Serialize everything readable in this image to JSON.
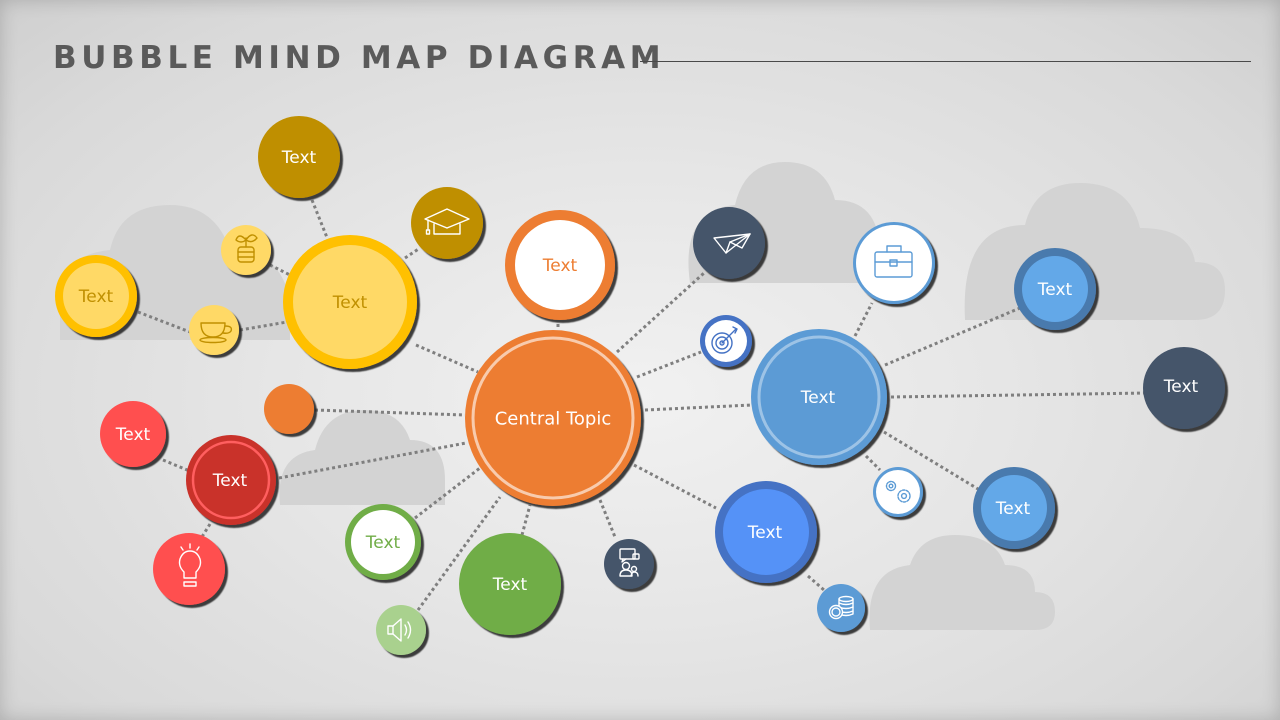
{
  "title": "BUBBLE MIND MAP DIAGRAM",
  "colors": {
    "orange": "#ED7D31",
    "gold": "#BF8F00",
    "yellow_ring": "#FFC000",
    "yellow_fill": "#FFD966",
    "yellow_text": "#C09000",
    "red": "#FF5050",
    "dark_red": "#C9302C",
    "green": "#70AD47",
    "light_green": "#A9D18E",
    "navy": "#44546A",
    "blue": "#5B9BD5",
    "bright_blue": "#5592F7",
    "ring_blue": "#4472C4",
    "steel_blue": "#4A7AAD",
    "sky_blue": "#64A8E8",
    "link": "#7F7F7F"
  },
  "central": {
    "label": "Central Topic"
  },
  "nodes": [
    {
      "id": "yellow-main",
      "label": "Text"
    },
    {
      "id": "gold-top",
      "label": "Text"
    },
    {
      "id": "yellow-left",
      "label": "Text"
    },
    {
      "id": "orange-white",
      "label": "Text"
    },
    {
      "id": "red-main",
      "label": "Text"
    },
    {
      "id": "red-left",
      "label": "Text"
    },
    {
      "id": "green-white",
      "label": "Text"
    },
    {
      "id": "green-main",
      "label": "Text"
    },
    {
      "id": "blue-bright",
      "label": "Text"
    },
    {
      "id": "blue-main",
      "label": "Text"
    },
    {
      "id": "blue-top-right",
      "label": "Text"
    },
    {
      "id": "navy-right",
      "label": "Text"
    },
    {
      "id": "blue-bottom-right",
      "label": "Text"
    }
  ],
  "icons": [
    {
      "id": "graduation",
      "name": "graduation-cap-icon"
    },
    {
      "id": "plant",
      "name": "plant-pot-icon"
    },
    {
      "id": "cup",
      "name": "coffee-cup-icon"
    },
    {
      "id": "bulb",
      "name": "light-bulb-icon"
    },
    {
      "id": "speaker",
      "name": "speaker-icon"
    },
    {
      "id": "chat",
      "name": "chat-users-icon"
    },
    {
      "id": "plane",
      "name": "paper-plane-icon"
    },
    {
      "id": "target",
      "name": "target-icon"
    },
    {
      "id": "briefcase",
      "name": "briefcase-icon"
    },
    {
      "id": "gears",
      "name": "gears-icon"
    },
    {
      "id": "coins",
      "name": "coins-icon"
    }
  ]
}
